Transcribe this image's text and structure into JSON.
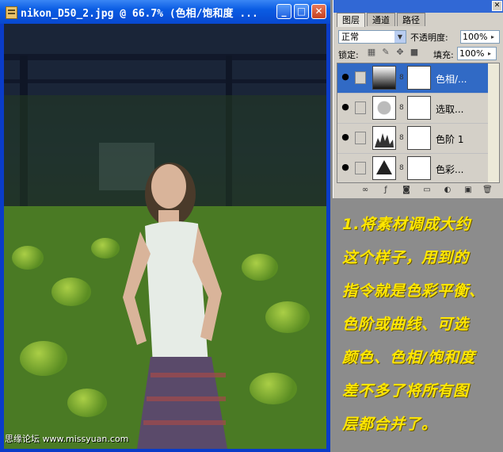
{
  "image_window": {
    "title": "nikon_D50_2.jpg @ 66.7% (色相/饱和度 ...",
    "watermark": "思缘论坛 www.missyuan.com"
  },
  "layers_panel": {
    "tabs": [
      {
        "label": "图层",
        "active": true
      },
      {
        "label": "通道",
        "active": false
      },
      {
        "label": "路径",
        "active": false
      }
    ],
    "blend_mode": "正常",
    "opacity_label": "不透明度:",
    "opacity_value": "100%",
    "lock_label": "锁定:",
    "fill_label": "填充:",
    "fill_value": "100%",
    "layers": [
      {
        "name": "色相/...",
        "selected": true,
        "thumb_icon": "hue-saturation-icon"
      },
      {
        "name": "选取...",
        "selected": false,
        "thumb_icon": "selective-color-icon"
      },
      {
        "name": "色阶 1",
        "selected": false,
        "thumb_icon": "levels-icon"
      },
      {
        "name": "色彩...",
        "selected": false,
        "thumb_icon": "color-balance-icon"
      }
    ]
  },
  "annotation_lines": [
    "1.将素材调成大约",
    "这个样子，用到的",
    "指令就是色彩平衡、",
    "色阶或曲线、可选",
    "颜色、色相/饱和度",
    "差不多了将所有图",
    "层都合并了。"
  ],
  "colors": {
    "titlebar": "#0a5ce3",
    "selected_layer": "#316ac5",
    "annotation_text": "#ffe600",
    "background": "#8c8c8c"
  }
}
